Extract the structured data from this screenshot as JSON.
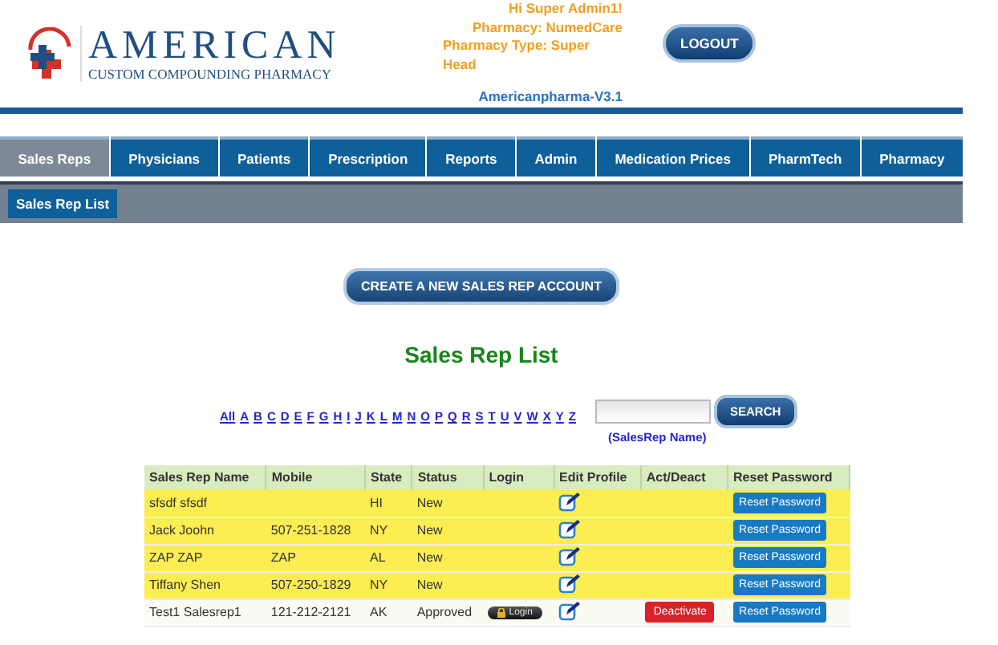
{
  "logo": {
    "title": "AMERICAN",
    "subtitle": "CUSTOM COMPOUNDING PHARMACY"
  },
  "user": {
    "greeting": "Hi Super Admin1!",
    "pharmacy": "Pharmacy: NumedCare",
    "pharmacy_type": "Pharmacy Type: Super Head",
    "version": "Americanpharma-V3.1"
  },
  "logout": "LOGOUT",
  "tabs": [
    {
      "label": "Sales Reps",
      "selected": true
    },
    {
      "label": "Physicians",
      "selected": false
    },
    {
      "label": "Patients",
      "selected": false
    },
    {
      "label": "Prescription",
      "selected": false
    },
    {
      "label": "Reports",
      "selected": false
    },
    {
      "label": "Admin",
      "selected": false
    },
    {
      "label": "Medication Prices",
      "selected": false
    },
    {
      "label": "PharmTech",
      "selected": false
    },
    {
      "label": "Pharmacy",
      "selected": false
    }
  ],
  "subnav": [
    {
      "label": "Sales Rep List",
      "selected": true
    }
  ],
  "create_button": "CREATE A NEW SALES REP ACCOUNT",
  "heading": "Sales Rep List",
  "letters": [
    "All",
    "A",
    "B",
    "C",
    "D",
    "E",
    "F",
    "G",
    "H",
    "I",
    "J",
    "K",
    "L",
    "M",
    "N",
    "O",
    "P",
    "Q",
    "R",
    "S",
    "T",
    "U",
    "V",
    "W",
    "X",
    "Y",
    "Z"
  ],
  "search": {
    "button": "SEARCH",
    "hint": "(SalesRep Name)"
  },
  "table": {
    "columns": [
      "Sales Rep Name",
      "Mobile",
      "State",
      "Status",
      "Login",
      "Edit Profile",
      "Act/Deact",
      "Reset Password"
    ],
    "rows": [
      {
        "name": "sfsdf sfsdf",
        "mobile": "",
        "state": "HI",
        "status": "New",
        "highlighted": true,
        "reset": "Reset Password"
      },
      {
        "name": "Jack Joohn",
        "mobile": "507-251-1828",
        "state": "NY",
        "status": "New",
        "highlighted": true,
        "reset": "Reset Password"
      },
      {
        "name": "ZAP ZAP",
        "mobile": "ZAP",
        "state": "AL",
        "status": "New",
        "highlighted": true,
        "reset": "Reset Password"
      },
      {
        "name": "Tiffany Shen",
        "mobile": "507-250-1829",
        "state": "NY",
        "status": "New",
        "highlighted": true,
        "reset": "Reset Password"
      },
      {
        "name": "Test1 Salesrep1",
        "mobile": "121-212-2121",
        "state": "AK",
        "status": "Approved",
        "highlighted": false,
        "login": "Login",
        "action": "Deactivate",
        "reset": "Reset Password"
      }
    ]
  }
}
